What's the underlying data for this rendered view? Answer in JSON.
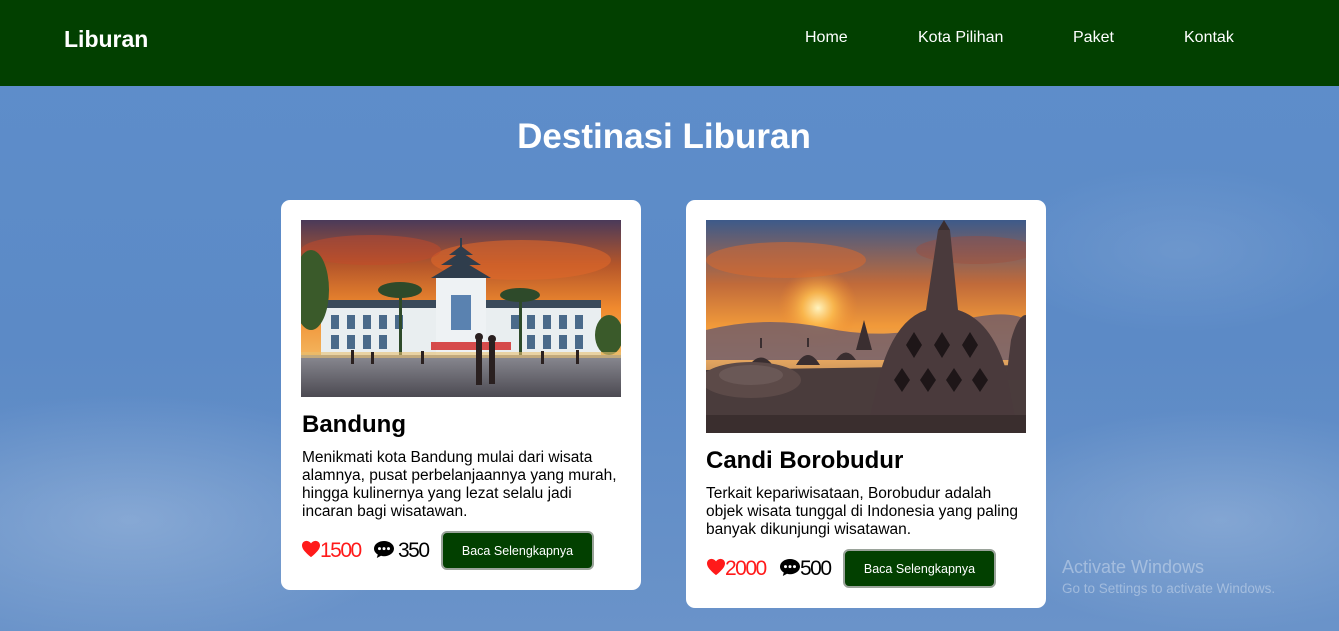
{
  "brand": "Liburan",
  "nav": {
    "items": [
      {
        "label": "Home"
      },
      {
        "label": "Kota Pilihan"
      },
      {
        "label": "Paket"
      },
      {
        "label": "Kontak"
      }
    ]
  },
  "page_title": "Destinasi Liburan",
  "cards": [
    {
      "title": "Bandung",
      "description": "Menikmati kota Bandung mulai dari wisata alamnya, pusat perbelanjaannya yang murah, hingga kulinernya yang lezat selalu jadi incaran bagi wisatawan.",
      "likes": "1500",
      "comments": "350",
      "button_label": "Baca Selengkapnya",
      "image_icon": "gedung-sate-photo"
    },
    {
      "title": "Candi Borobudur",
      "description": "Terkait kepariwisataan, Borobudur adalah objek wisata tunggal di Indonesia yang paling banyak dikunjungi wisatawan.",
      "likes": "2000",
      "comments": "500",
      "button_label": "Baca Selengkapnya",
      "image_icon": "borobudur-stupa-photo"
    }
  ],
  "os_watermark": {
    "line1": "Activate Windows",
    "line2": "Go to Settings to activate Windows."
  },
  "colors": {
    "nav_bg": "#024000",
    "button_bg": "#024000",
    "like_red": "#ff1a1a",
    "page_bg": "#5b89c2"
  }
}
